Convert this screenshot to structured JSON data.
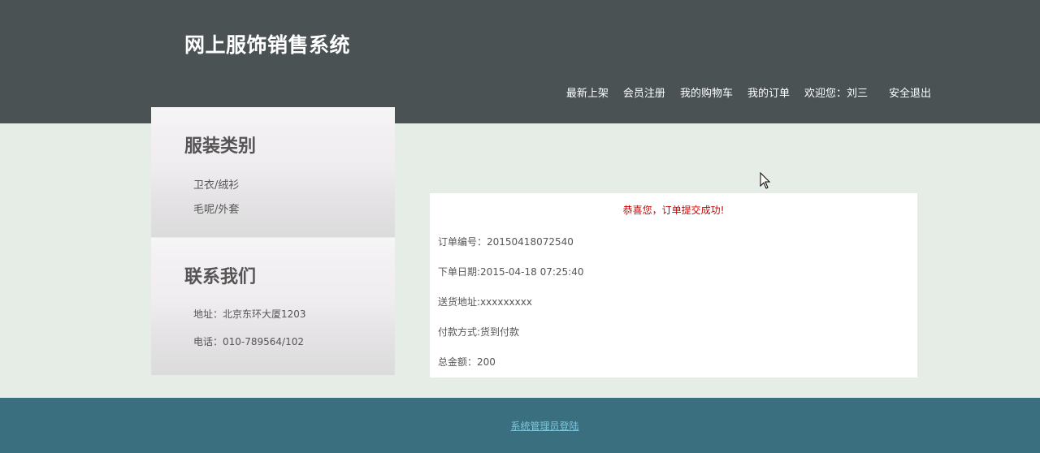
{
  "header": {
    "site_title": "网上服饰销售系统",
    "nav": {
      "new_arrivals": "最新上架",
      "register": "会员注册",
      "cart": "我的购物车",
      "orders": "我的订单",
      "welcome": "欢迎您：刘三",
      "logout": "安全退出"
    }
  },
  "sidebar": {
    "categories_title": "服装类别",
    "categories": [
      "卫衣/绒衫",
      "毛呢/外套"
    ],
    "contact_title": "联系我们",
    "address": "地址：北京东环大厦1203",
    "phone": "电话：010-789564/102"
  },
  "order": {
    "success_message": "恭喜您，订单提交成功!",
    "number": "订单编号：20150418072540",
    "date": "下单日期:2015-04-18 07:25:40",
    "address": "送货地址:xxxxxxxxx",
    "payment": "付款方式:货到付款",
    "total": "总金额：200"
  },
  "footer": {
    "admin_login": "系统管理员登陆"
  }
}
